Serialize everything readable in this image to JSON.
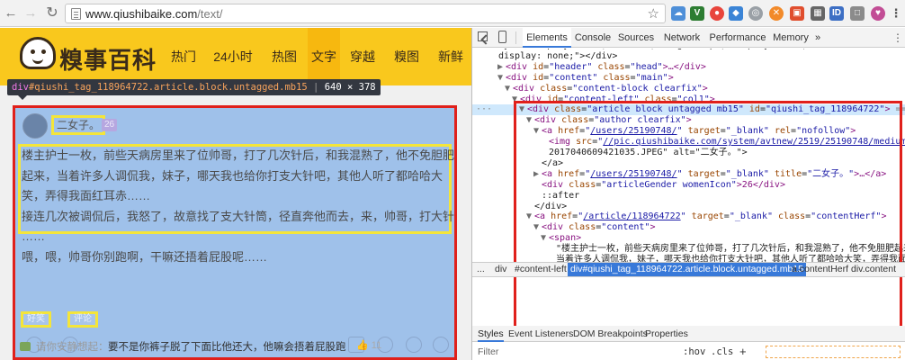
{
  "browser": {
    "url_host": "www.qiushibaike.com",
    "url_path": "/text/"
  },
  "site": {
    "logo_text": "糗事百科",
    "nav": [
      "热门",
      "24小时",
      "热图",
      "文字",
      "穿越",
      "糗图",
      "新鲜"
    ],
    "active_nav": "文字"
  },
  "inspector_tooltip": {
    "tag": "div",
    "selector": "#qiushi_tag_118964722.article.block.untagged.mb15",
    "size": "640 × 378"
  },
  "article": {
    "author": "二女子。",
    "age": "26",
    "content_lines": [
      "楼主护士一枚，前些天病房里来了位帅哥，打了几次针后，和我混熟了，他不免胆肥",
      "起来，当着许多人调侃我，妹子，哪天我也给你打支大针吧，其他人听了都哈哈大",
      "笑，弄得我面红耳赤……",
      "接连几次被调侃后，我怒了，故意找了支大针筒，径直奔他而去，来，帅哥，打大针",
      "……",
      "喂，喂，帅哥你别跑啊，干嘛还捂着屁股呢……"
    ],
    "stats": [
      "好笑",
      "评论"
    ],
    "hot_comment_user": "请你安静想起：",
    "hot_comment_text": "要不是你裤子脱了下面比他还大，他嘛会捂着屁股跑",
    "hot_comment_likes": "11"
  },
  "devtools": {
    "tabs": [
      "Elements",
      "Console",
      "Sources",
      "Network",
      "Performance",
      "Memory"
    ],
    "active_tab": "Elements",
    "more": "»",
    "dom": [
      {
        "indent": 0,
        "raw": "tyle=\"display: none; \"> ... , height: 0px; display: none;\"></div>"
      },
      {
        "indent": 0,
        "raw": "display: none;\"></div>"
      },
      {
        "indent": 1,
        "tw": "▶",
        "tag": "div",
        "attr": "id",
        "val": "header",
        "attr2": "class",
        "val2": "head",
        "tail": ">…</div>"
      },
      {
        "indent": 1,
        "tw": "▼",
        "tag": "div",
        "attr": "id",
        "val": "content",
        "attr2": "class",
        "val2": "main",
        "tail": ">"
      },
      {
        "indent": 2,
        "tw": "▼",
        "tag": "div",
        "attr": "class",
        "val": "content-block clearfix",
        "tail": ">"
      },
      {
        "indent": 3,
        "tw": "▼",
        "tag": "div",
        "attr": "id",
        "val": "content-left",
        "attr2": "class",
        "val2": "col1",
        "tail": ">"
      },
      {
        "indent": 4,
        "tw": "▼",
        "tag": "div",
        "attr": "class",
        "val": "article block untagged mb15",
        "attr2": "id",
        "val2": "qiushi_tag_118964722",
        "tail": "> == $0",
        "sel": true
      },
      {
        "indent": 5,
        "tw": "▼",
        "tag": "div",
        "attr": "class",
        "val": "author clearfix",
        "tail": ">"
      },
      {
        "indent": 6,
        "tw": "▼",
        "tag": "a",
        "attr": "href",
        "val": "/users/25190748/",
        "link": true,
        "attr2": "target",
        "val2": "_blank",
        "attr3": "rel",
        "val3": "nofollow",
        "tail": ">"
      },
      {
        "indent": 7,
        "tag": "img",
        "attr": "src",
        "val": "//pic.qiushibaike.com/system/avtnew/2519/25190748/medium/",
        "link": true,
        "tail": ""
      },
      {
        "indent": 7,
        "text": "2017040609421035.JPEG\" alt=\"二女子。\">"
      },
      {
        "indent": 6,
        "text": "</a>"
      },
      {
        "indent": 6,
        "tw": "▶",
        "tag": "a",
        "attr": "href",
        "val": "/users/25190748/",
        "link": true,
        "attr2": "target",
        "val2": "_blank",
        "attr3": "title",
        "val3": "二女子。",
        "tail": ">…</a>"
      },
      {
        "indent": 6,
        "tag": "div",
        "attr": "class",
        "val": "articleGender womenIcon",
        "tail": ">26</div>"
      },
      {
        "indent": 6,
        "text": "::after"
      },
      {
        "indent": 5,
        "text": "</div>"
      },
      {
        "indent": 5,
        "tw": "▼",
        "tag": "a",
        "attr": "href",
        "val": "/article/118964722",
        "link": true,
        "attr2": "target",
        "val2": "_blank",
        "attr3": "class",
        "val3": "contentHerf",
        "tail": ">"
      },
      {
        "indent": 6,
        "tw": "▼",
        "tag": "div",
        "attr": "class",
        "val": "content",
        "tail": ">"
      },
      {
        "indent": 7,
        "tw": "▼",
        "tag": "span",
        "tail": ">"
      },
      {
        "indent": 8,
        "text": "\"楼主护士一枚，前些天病房里来了位帅哥，打了几次针后，和我混熟了，他不免胆肥起来，"
      },
      {
        "indent": 8,
        "text": "当着许多人调侃我，妹子，哪天我也给你打支大针吧，其他人听了都哈哈大笑，弄得我面红"
      },
      {
        "indent": 8,
        "text": "耳赤……\""
      },
      {
        "indent": 8,
        "text": "<br>"
      },
      {
        "indent": 8,
        "text": "\"接连几次被调侃后，我怒了，故意找了支大针筒，径直奔他而去，来，帅哥，打大针……\""
      }
    ],
    "breadcrumbs": [
      "...",
      "div",
      "#content-left",
      "div#qiushi_tag_118964722.article.block.untagged.mb15",
      "a.contentHerf",
      "div.content"
    ],
    "active_crumb": "div#qiushi_tag_118964722.article.block.untagged.mb15",
    "styles_tabs": [
      "Styles",
      "Event Listeners",
      "DOM Breakpoints",
      "Properties"
    ],
    "active_styles_tab": "Styles",
    "filter_label": "Filter",
    "hov": ":hov",
    "cls": ".cls",
    "plus": "+"
  },
  "colors": {
    "site_yellow": "#f9c81d",
    "highlight_blue": "#9fc1ea",
    "red_box": "#e0201b",
    "yellow_box": "#f4e53a",
    "devtools_accent": "#3879d9"
  }
}
